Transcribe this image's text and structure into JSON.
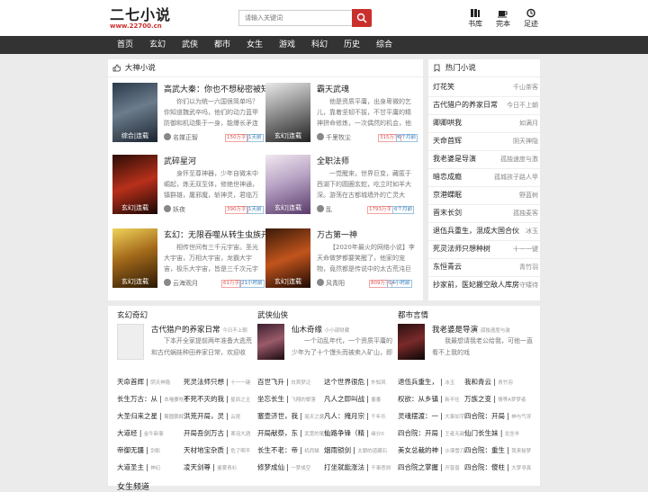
{
  "header": {
    "logo_title": "二七小说",
    "logo_url": "www.22700.cn",
    "search_placeholder": "请输入关键词",
    "links": [
      {
        "label": "书库"
      },
      {
        "label": "完本"
      },
      {
        "label": "足迹"
      }
    ]
  },
  "nav": [
    "首页",
    "玄幻",
    "武侠",
    "都市",
    "女生",
    "游戏",
    "科幻",
    "历史",
    "综合"
  ],
  "featured": {
    "title": "大神小说",
    "books": [
      {
        "title": "高武大秦：你也不想秘密被知",
        "desc": "你们以为统一六国很简单吗？你知道魏武卒吗，他们的动力蓝甲防御和机动集于一身，能爆长矛连",
        "author": "名媒正智",
        "tag1": "150万字",
        "tag2": "1天前",
        "cover": "综合|连载"
      },
      {
        "title": "霸天武魂",
        "desc": "他是资质平庸，出身卑微的乞儿，靠着坚韧不拔，不甘平庸的精神拼命修炼，一次偶然的机会，他",
        "author": "千里牧尘",
        "tag1": "315万字",
        "tag2": "6个月前",
        "cover": "玄幻|连载"
      },
      {
        "title": "武碎星河",
        "desc": "身怀至尊神器，少年自微末中崛起，炼无双至体，修绝世神通，镇群雄，屠邪魔，斩神灵，君临万",
        "author": "妖夜",
        "tag1": "390万字",
        "tag2": "1天前",
        "cover": "玄幻|连载"
      },
      {
        "title": "全职法师",
        "desc": "一觉醒来，世界巨变，藏匿于西湖下的圆圈玄蛇，吃立时如羊大深。游荡在古都城墙外的亡灵大",
        "author": "乱",
        "tag1": "1793万字",
        "tag2": "6个月前",
        "cover": "玄幻|连载"
      },
      {
        "title": "玄幻：无限吞噬从转生虫族开",
        "desc": "相传世间有三千元宇宙。圣光大宇宙，万相大宇宙，龙霸大宇宙，极乐大宇宙，皆是三千次元宇",
        "author": "云海观月",
        "tag1": "61万字",
        "tag2": "21小时前",
        "cover": "玄幻|连载"
      },
      {
        "title": "万古第一神",
        "desc": "【2020年最火的网络小说】李天命做梦都要笑醒了，他家的宠物，竟然都是传说中的太古荒沌巨",
        "author": "风青阳",
        "tag1": "809万字",
        "tag2": "14小时前",
        "cover": "玄幻|连载"
      }
    ]
  },
  "hot": {
    "title": "热门小说",
    "items": [
      {
        "name": "灯花笑",
        "author": "千山茶客"
      },
      {
        "name": "古代猎户的养家日常",
        "author": "今日不上朝"
      },
      {
        "name": "卿卿哄我",
        "author": "如满月"
      },
      {
        "name": "天命首辉",
        "author": "阴天神隐"
      },
      {
        "name": "我老婆是导演",
        "author": "孤独速度与激"
      },
      {
        "name": "暗恋成瘾",
        "author": "孤城孩子路人甲"
      },
      {
        "name": "京港蝶眠",
        "author": "野蓝树"
      },
      {
        "name": "晋末长剑",
        "author": "孤独麦客"
      },
      {
        "name": "退伍兵重生，混成大国合伙",
        "author": "冰玉"
      },
      {
        "name": "死灵法师只想种树",
        "author": "十一一键"
      },
      {
        "name": "东恒青云",
        "author": "青竹羽"
      },
      {
        "name": "抄家前，医妃搬空敌人库房",
        "author": "守矮待"
      }
    ]
  },
  "sections": [
    {
      "title": "玄幻奇幻",
      "feat_title": "古代猎户的养家日常",
      "feat_author": "今日不上朝",
      "feat_desc": "下本开全家提前两年准备大逃荒和古代蜗娃种田养家日常，欢迎收",
      "rows": [
        [
          "天命首辉",
          "阴天神隐",
          "死灵法师只想",
          "十一一键"
        ],
        [
          "长生万古：从",
          "本喵要吃鱼",
          "不死不灭的我",
          "星辰之主"
        ],
        [
          "大圣归来之星",
          "蜀圆鹏辉",
          "洪荒开局，灵",
          "云昆"
        ],
        [
          "大道经",
          "金牛新事",
          "开局吾剑万古",
          "寒泡大酒"
        ],
        [
          "帝御无疆",
          "剑影",
          "天材地宝杂质",
          "危了啊不"
        ],
        [
          "大道圣主",
          "神幻",
          "凌天剑尊",
          "鉴雾青衫"
        ]
      ]
    },
    {
      "title": "武侠仙侠",
      "feat_title": "仙木奇缘",
      "feat_author": "小小部财藏",
      "feat_desc": "一个动乱年代，一个资质平庸的少年为了十个馒头而被卖入矿山，即因偶然得",
      "rows": [
        [
          "百世飞升",
          "白首梦泛",
          "这个世界很危",
          "外知风"
        ],
        [
          "坐忘长生",
          "飞翔的黎落",
          "凡人之即叫战",
          "番番"
        ],
        [
          "塞壶济世，我",
          "瑶天之瑟",
          "凡人：掩月宗",
          "千年乐"
        ],
        [
          "开局献祭，东",
          "武宽的笔夜",
          "仙路争锋（精",
          "缘分0"
        ],
        [
          "长生不老：帝",
          "机而猫",
          "烟雨锁剑",
          "太朝的道藏石"
        ],
        [
          "修梦成仙",
          "一梦成空",
          "打坐就能涨法",
          "千事恶则"
        ]
      ]
    },
    {
      "title": "都市言情",
      "feat_title": "我老婆是导演",
      "feat_author": "孤独速度与激",
      "feat_desc": "我最想请我老公给我，可他一直看不上我的戏",
      "rows": [
        [
          "退伍兵重生，",
          "冰玉",
          "我和青云",
          "青竹羽"
        ],
        [
          "权欲：从乡镇",
          "新不住",
          "万族之变",
          "情等A梦梦者"
        ],
        [
          "灵魂摆渡：一",
          "大事如宇",
          "四合院：开局",
          "神与气讶"
        ],
        [
          "四合院：开局",
          "王者无敌",
          "仙门长生妹",
          "龙坐羊"
        ],
        [
          "美女总裁的神",
          "沙漠雪刀",
          "四合院：重生",
          "我来秘梦"
        ],
        [
          "四合院之掌握",
          "开普普",
          "四合院：傻柱",
          "大梦寻真"
        ]
      ]
    }
  ],
  "footer_section_title": "女生频道"
}
